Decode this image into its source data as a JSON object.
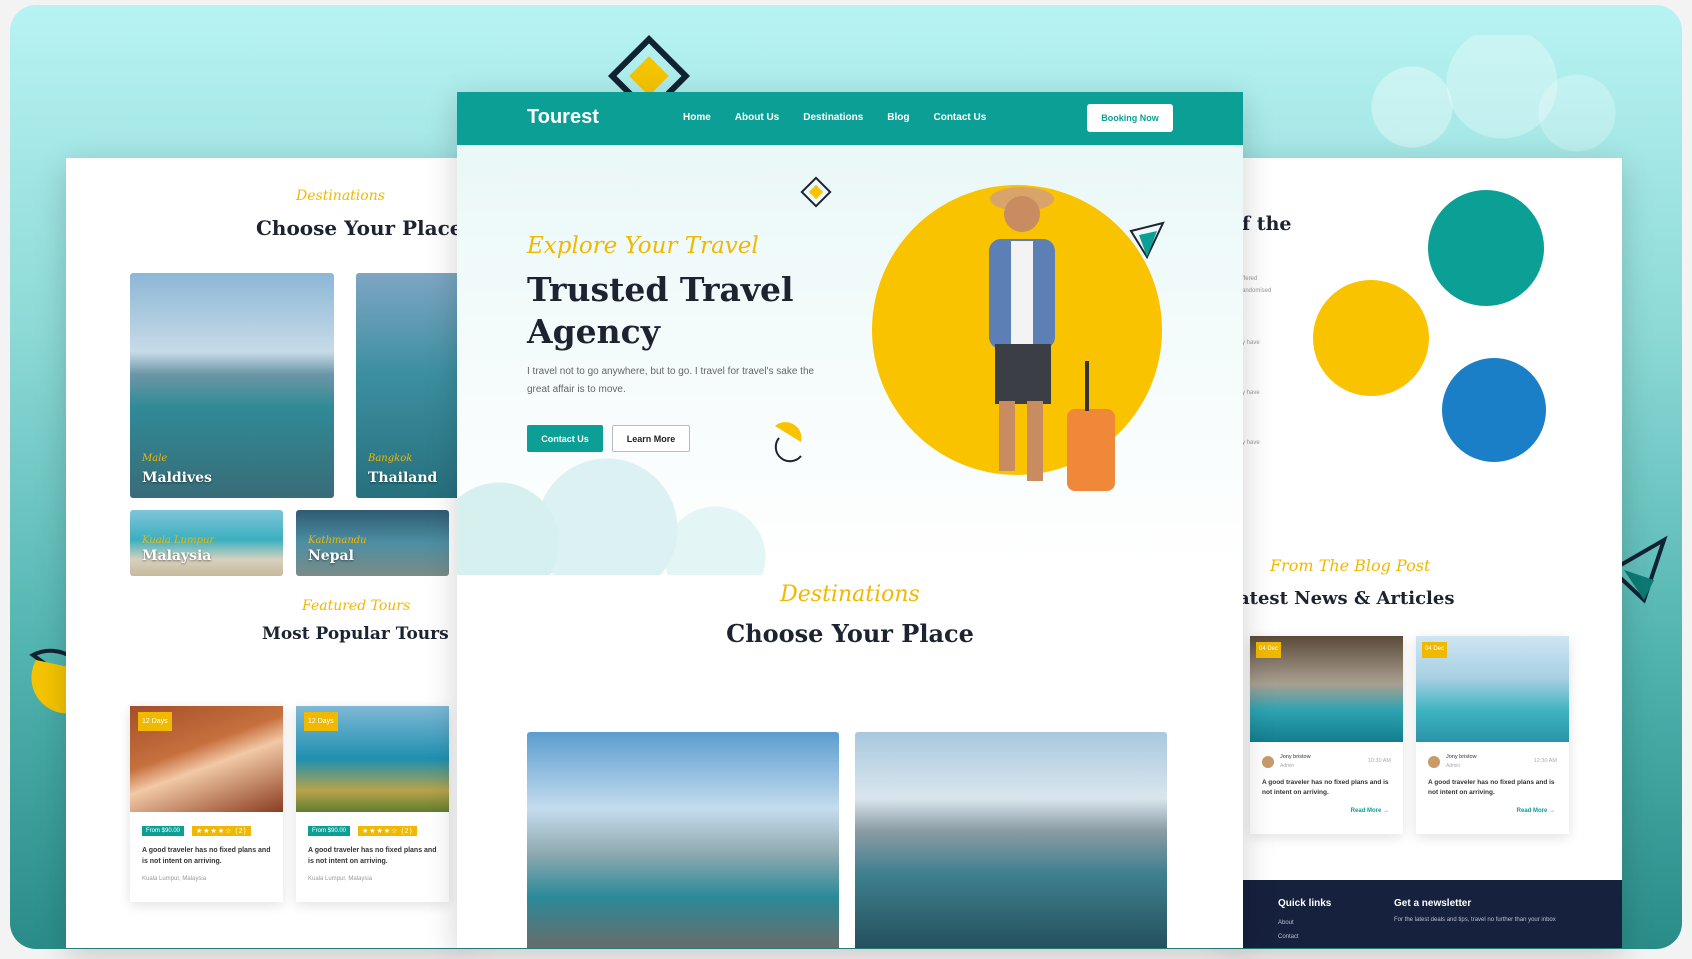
{
  "left_panel": {
    "destinations_script": "Destinations",
    "heading": "Choose Your Place",
    "destinations": [
      {
        "script": "Male",
        "name": "Maldives"
      },
      {
        "script": "Bangkok",
        "name": "Thailand"
      },
      {
        "script": "Kuala Lumpur",
        "name": "Malaysia"
      },
      {
        "script": "Kathmandu",
        "name": "Nepal"
      }
    ],
    "tours_script": "Featured Tours",
    "tours_heading": "Most Popular Tours",
    "tours": [
      {
        "days": "12 Days",
        "price": "From $90.00",
        "stars": "★★★★☆ (2)",
        "desc": "A good traveler has no fixed plans and is not intent on arriving.",
        "location": "Kuala Lumpur, Malaysia"
      },
      {
        "days": "12 Days",
        "price": "From $90.00",
        "stars": "★★★★☆ (2)",
        "desc": "A good traveler has no fixed plans and is not intent on arriving.",
        "location": "Kuala Lumpur, Malaysia"
      }
    ]
  },
  "nav": {
    "brand": "Tourest",
    "links": [
      "Home",
      "About Us",
      "Destinations",
      "Blog",
      "Contact Us"
    ],
    "cta": "Booking Now"
  },
  "hero": {
    "script": "Explore Your Travel",
    "title": "Trusted Travel Agency",
    "description": "I travel not to go anywhere, but to go. I travel for travel's sake the great affair is to move.",
    "primary_button": "Contact Us",
    "secondary_button": "Learn More"
  },
  "center_destinations": {
    "script": "Destinations",
    "title": "Choose Your Place"
  },
  "right_panel": {
    "heading_fragment": "f the",
    "text_fragments": [
      "ffered",
      "andomised",
      "y have",
      "y have",
      "y have"
    ],
    "blog_script": "From The Blog Post",
    "blog_heading": "atest News & Articles",
    "posts": [
      {
        "date": "04 Dec",
        "author": "Jony bristow",
        "role": "Admin",
        "time": "10:30 AM",
        "desc": "A good traveler has no fixed plans and is not intent on arriving.",
        "more": "Read More →"
      },
      {
        "date": "04 Dec",
        "author": "Jony bristow",
        "role": "Admin",
        "time": "12:30 AM",
        "desc": "A good traveler has no fixed plans and is not intent on arriving.",
        "more": "Read More →"
      }
    ],
    "footer": {
      "quick_links": "Quick links",
      "links": [
        "About",
        "Contact"
      ],
      "newsletter_title": "Get a newsletter",
      "newsletter_text": "For the latest deals and tips, travel no further than your inbox"
    }
  },
  "colors": {
    "brand_teal": "#0c9f96",
    "accent_yellow": "#f9c300",
    "heading_dark": "#1c2331",
    "footer_navy": "#16213e"
  }
}
